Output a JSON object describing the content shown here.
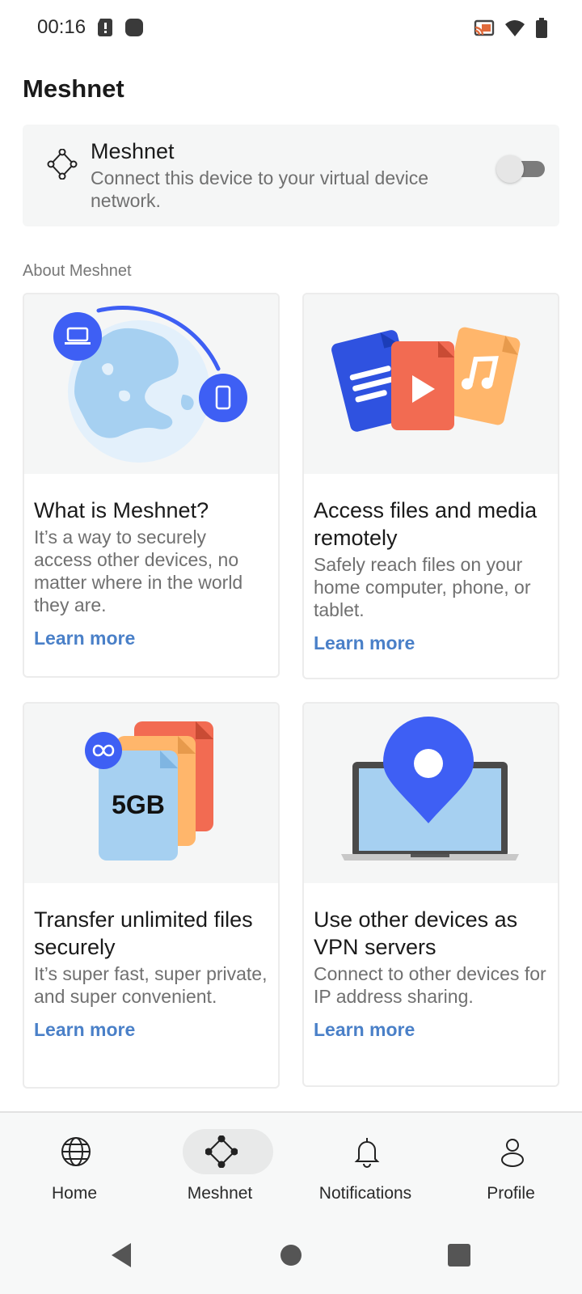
{
  "status_bar": {
    "time": "00:16",
    "left_icons": [
      "alert-card-icon",
      "app-notification-icon"
    ],
    "right_icons": [
      "cast-icon",
      "wifi-icon",
      "battery-icon"
    ]
  },
  "page": {
    "title": "Meshnet"
  },
  "meshnet_toggle": {
    "title": "Meshnet",
    "description": "Connect this device to your virtual device network.",
    "enabled": false
  },
  "about": {
    "section_label": "About Meshnet",
    "cards": [
      {
        "illustration": "globe-devices-illustration",
        "title": "What is Meshnet?",
        "description": "It’s a way to securely access other devices, no matter where in the world they are.",
        "link": "Learn more"
      },
      {
        "illustration": "files-media-illustration",
        "title": "Access files and media remotely",
        "description": "Safely reach files on your home computer, phone, or tablet.",
        "link": "Learn more"
      },
      {
        "illustration": "unlimited-files-illustration",
        "illustration_text": "5GB",
        "title": "Transfer unlimited files securely",
        "description": "It’s super fast, super private, and super convenient.",
        "link": "Learn more"
      },
      {
        "illustration": "laptop-location-illustration",
        "title": "Use other devices as VPN servers",
        "description": "Connect to other devices for IP address sharing.",
        "link": "Learn more"
      }
    ]
  },
  "bottom_nav": {
    "items": [
      {
        "label": "Home",
        "icon": "globe-icon",
        "active": false
      },
      {
        "label": "Meshnet",
        "icon": "meshnet-icon",
        "active": true
      },
      {
        "label": "Notifications",
        "icon": "bell-icon",
        "active": false
      },
      {
        "label": "Profile",
        "icon": "person-icon",
        "active": false
      }
    ]
  },
  "system_nav": [
    "back-button",
    "home-button",
    "recents-button"
  ],
  "colors": {
    "accent_blue": "#3e5ff4",
    "link_blue": "#4a80c8",
    "card_bg": "#f5f6f6",
    "nav_bg": "#f7f8f8"
  }
}
